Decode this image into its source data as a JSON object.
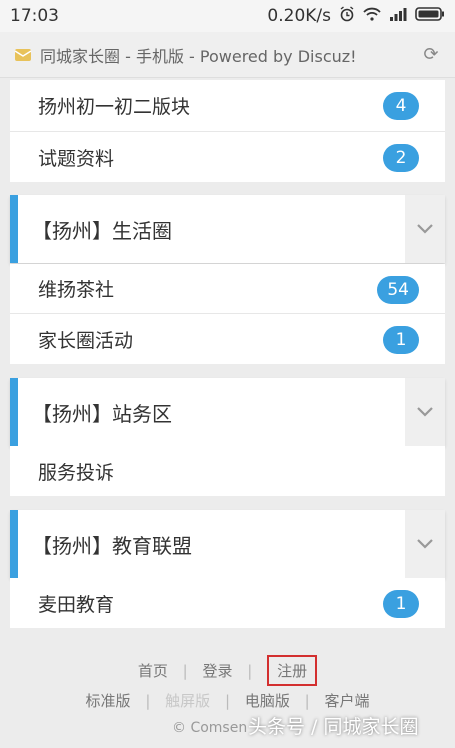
{
  "status": {
    "time": "17:03",
    "speed": "0.20K/s"
  },
  "browser": {
    "title": "同城家长圈 - 手机版 - Powered by Discuz!"
  },
  "forum_top": {
    "rows": [
      {
        "label": "扬州初一初二版块",
        "count": "4"
      },
      {
        "label": "试题资料",
        "count": "2"
      }
    ]
  },
  "sections": [
    {
      "title": "【扬州】生活圈",
      "rows": [
        {
          "label": "维扬茶社",
          "count": "54"
        },
        {
          "label": "家长圈活动",
          "count": "1"
        }
      ]
    },
    {
      "title": "【扬州】站务区",
      "rows": [
        {
          "label": "服务投诉",
          "count": ""
        }
      ]
    },
    {
      "title": "【扬州】教育联盟",
      "rows": [
        {
          "label": "麦田教育",
          "count": "1"
        }
      ]
    }
  ],
  "footer": {
    "links1": [
      "首页",
      "登录",
      "注册"
    ],
    "links2": [
      "标准版",
      "触屏版",
      "电脑版",
      "客户端"
    ],
    "copyright": "© Comsen",
    "watermark": "头条号 / 同城家长圈"
  },
  "colors": {
    "accent": "#3aa0e0",
    "highlight": "#d32f2f"
  }
}
